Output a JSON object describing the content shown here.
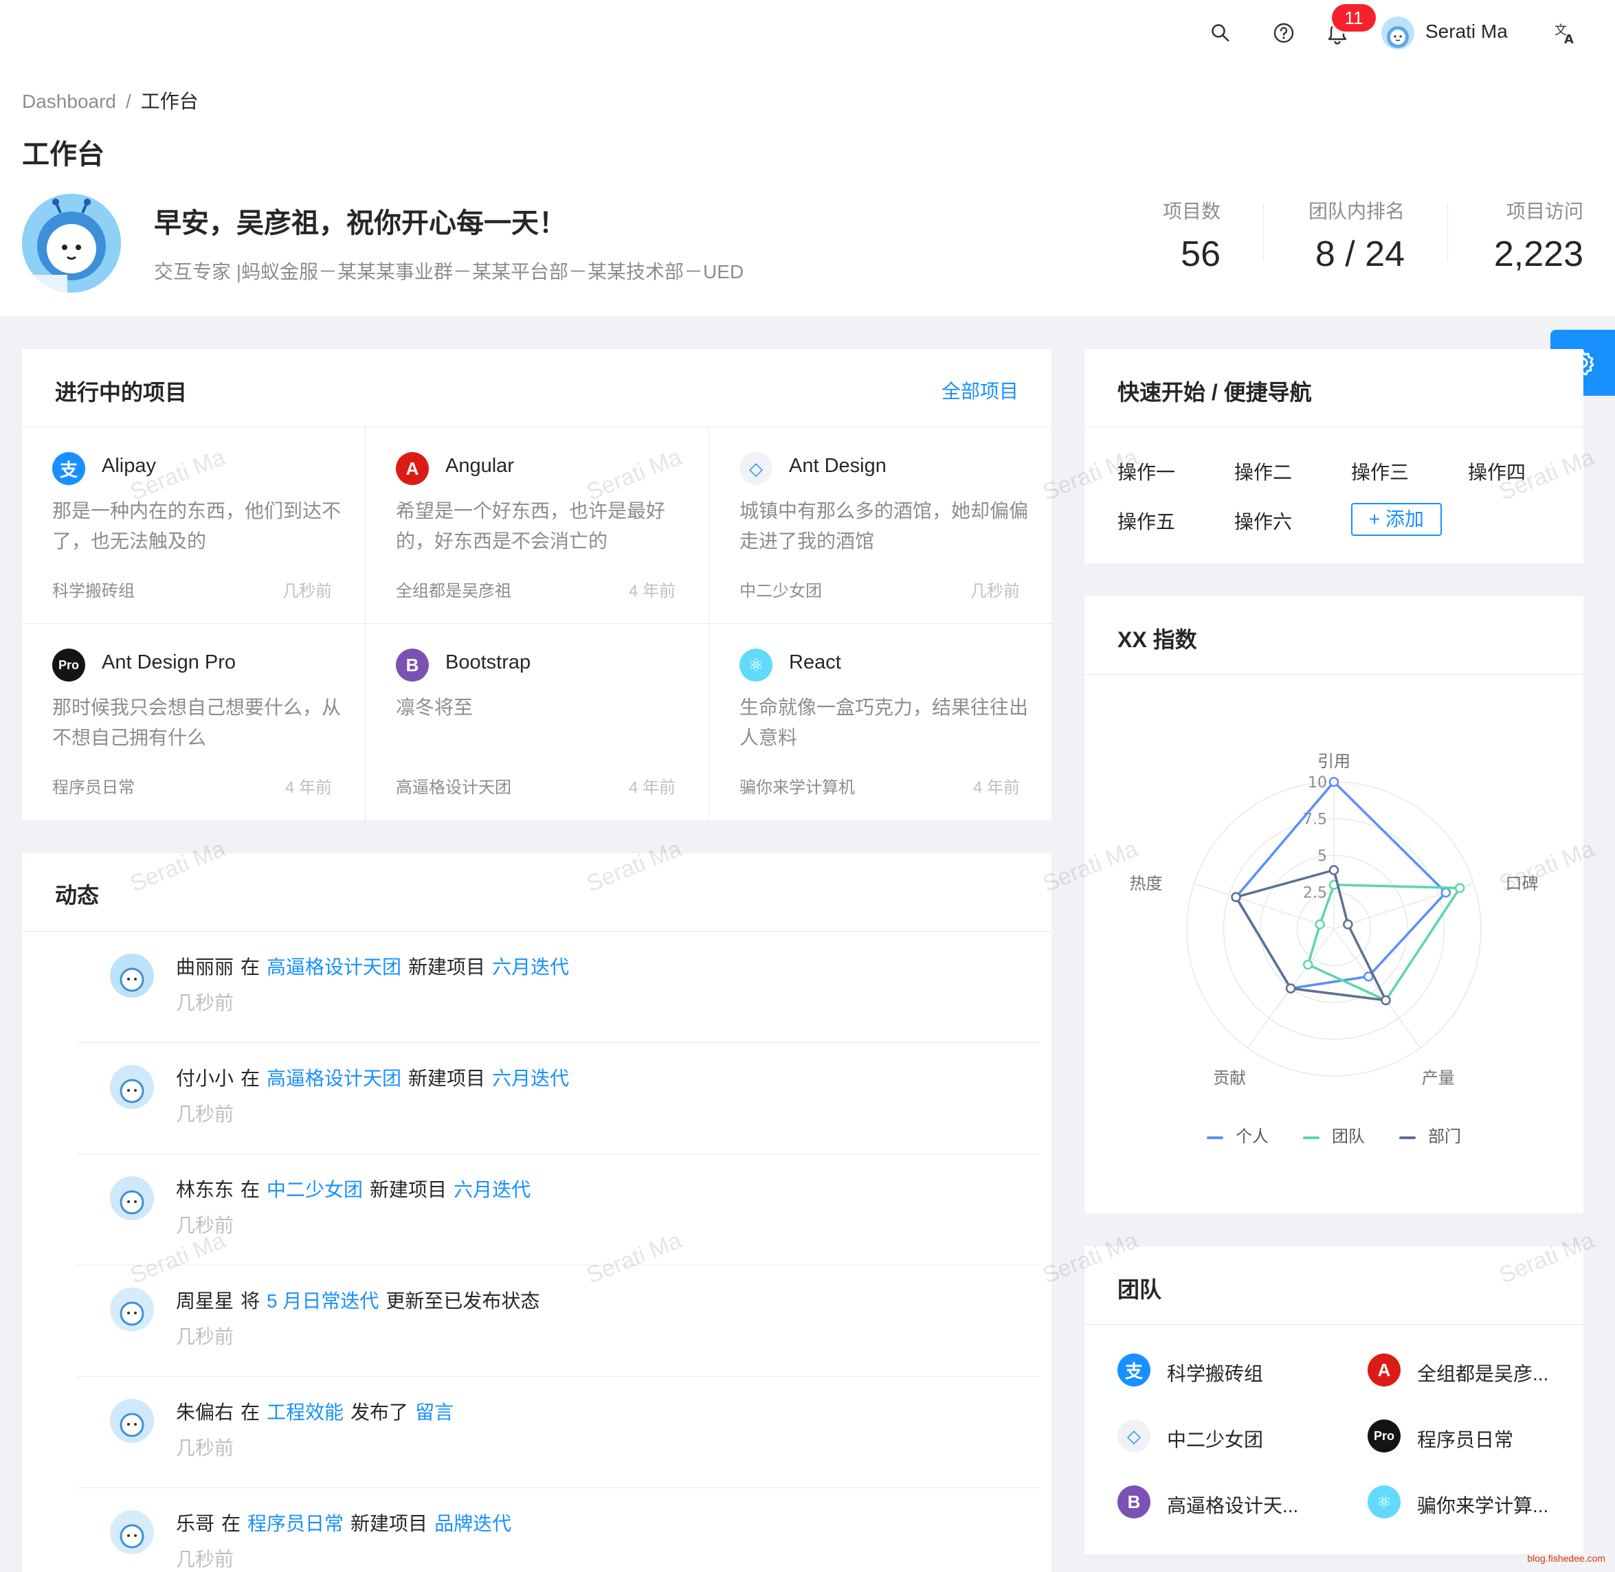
{
  "header": {
    "notification_count": "11",
    "user_name": "Serati Ma",
    "icons": [
      "search-icon",
      "question-circle-icon",
      "bell-icon",
      "translate-icon"
    ]
  },
  "breadcrumb": {
    "home": "Dashboard",
    "separator": "/",
    "current": "工作台"
  },
  "page_title": "工作台",
  "profile": {
    "greeting": "早安，吴彦祖，祝你开心每一天！",
    "subtitle": "交互专家 |蚂蚁金服－某某某事业群－某某平台部－某某技术部－UED"
  },
  "stats": [
    {
      "label": "项目数",
      "value": "56"
    },
    {
      "label": "团队内排名",
      "value": "8 / 24"
    },
    {
      "label": "项目访问",
      "value": "2,223"
    }
  ],
  "projects": {
    "title": "进行中的项目",
    "extra": "全部项目",
    "items": [
      {
        "name": "Alipay",
        "desc": "那是一种内在的东西，他们到达不了，也无法触及的",
        "group": "科学搬砖组",
        "time": "几秒前",
        "logo": "alipay-logo",
        "color": "#1890ff",
        "glyph": "支"
      },
      {
        "name": "Angular",
        "desc": "希望是一个好东西，也许是最好的，好东西是不会消亡的",
        "group": "全组都是吴彦祖",
        "time": "4 年前",
        "logo": "angular-logo",
        "color": "#dd1b16",
        "glyph": "A"
      },
      {
        "name": "Ant Design",
        "desc": "城镇中有那么多的酒馆，她却偏偏走进了我的酒馆",
        "group": "中二少女团",
        "time": "几秒前",
        "logo": "ant-design-logo",
        "color": "#f0f2f5",
        "glyph": "◇"
      },
      {
        "name": "Ant Design Pro",
        "desc": "那时候我只会想自己想要什么，从不想自己拥有什么",
        "group": "程序员日常",
        "time": "4 年前",
        "logo": "ant-design-pro-logo",
        "color": "#141414",
        "glyph": "Pro"
      },
      {
        "name": "Bootstrap",
        "desc": "凛冬将至",
        "group": "高逼格设计天团",
        "time": "4 年前",
        "logo": "bootstrap-logo",
        "color": "#7952b3",
        "glyph": "B"
      },
      {
        "name": "React",
        "desc": "生命就像一盒巧克力，结果往往出人意料",
        "group": "骗你来学计算机",
        "time": "4 年前",
        "logo": "react-logo",
        "color": "#61dafb",
        "glyph": "⚛"
      }
    ]
  },
  "activity": {
    "title": "动态",
    "items": [
      {
        "user": "曲丽丽",
        "verb": "在",
        "link1": "高逼格设计天团",
        "action": "新建项目",
        "link2": "六月迭代",
        "time": "几秒前"
      },
      {
        "user": "付小小",
        "verb": "在",
        "link1": "高逼格设计天团",
        "action": "新建项目",
        "link2": "六月迭代",
        "time": "几秒前"
      },
      {
        "user": "林东东",
        "verb": "在",
        "link1": "中二少女团",
        "action": "新建项目",
        "link2": "六月迭代",
        "time": "几秒前"
      },
      {
        "user": "周星星",
        "verb": "将",
        "link1": "5 月日常迭代",
        "action": "更新至已发布状态",
        "link2": "",
        "time": "几秒前"
      },
      {
        "user": "朱偏右",
        "verb": "在",
        "link1": "工程效能",
        "action": "发布了",
        "link2": "留言",
        "time": "几秒前"
      },
      {
        "user": "乐哥",
        "verb": "在",
        "link1": "程序员日常",
        "action": "新建项目",
        "link2": "品牌迭代",
        "time": "几秒前"
      }
    ]
  },
  "quick_nav": {
    "title": "快速开始 / 便捷导航",
    "links": [
      "操作一",
      "操作二",
      "操作三",
      "操作四",
      "操作五",
      "操作六"
    ],
    "add_label": "+ 添加"
  },
  "index_card": {
    "title": "XX 指数"
  },
  "chart_data": {
    "type": "radar",
    "indicators": [
      "引用",
      "口碑",
      "产量",
      "贡献",
      "热度"
    ],
    "ticks": [
      "2.5",
      "5",
      "7.5",
      "10"
    ],
    "max": 10,
    "series": [
      {
        "name": "个人",
        "color": "#5b8ff9",
        "values": [
          10,
          8,
          4,
          5,
          7
        ]
      },
      {
        "name": "团队",
        "color": "#5ad8a6",
        "values": [
          3,
          9,
          6,
          3,
          1
        ]
      },
      {
        "name": "部门",
        "color": "#5d7092",
        "values": [
          4,
          1,
          6,
          5,
          7
        ]
      }
    ]
  },
  "team": {
    "title": "团队",
    "items": [
      {
        "name": "科学搬砖组",
        "color": "#1890ff",
        "glyph": "支"
      },
      {
        "name": "全组都是吴彦...",
        "color": "#dd1b16",
        "glyph": "A"
      },
      {
        "name": "中二少女团",
        "color": "#f0f2f5",
        "glyph": "◇"
      },
      {
        "name": "程序员日常",
        "color": "#141414",
        "glyph": "Pro"
      },
      {
        "name": "高逼格设计天...",
        "color": "#7952b3",
        "glyph": "B"
      },
      {
        "name": "骗你来学计算...",
        "color": "#61dafb",
        "glyph": "⚛"
      }
    ]
  },
  "watermark": "Serati Ma",
  "footer_mark": "blog.fishedee.com"
}
